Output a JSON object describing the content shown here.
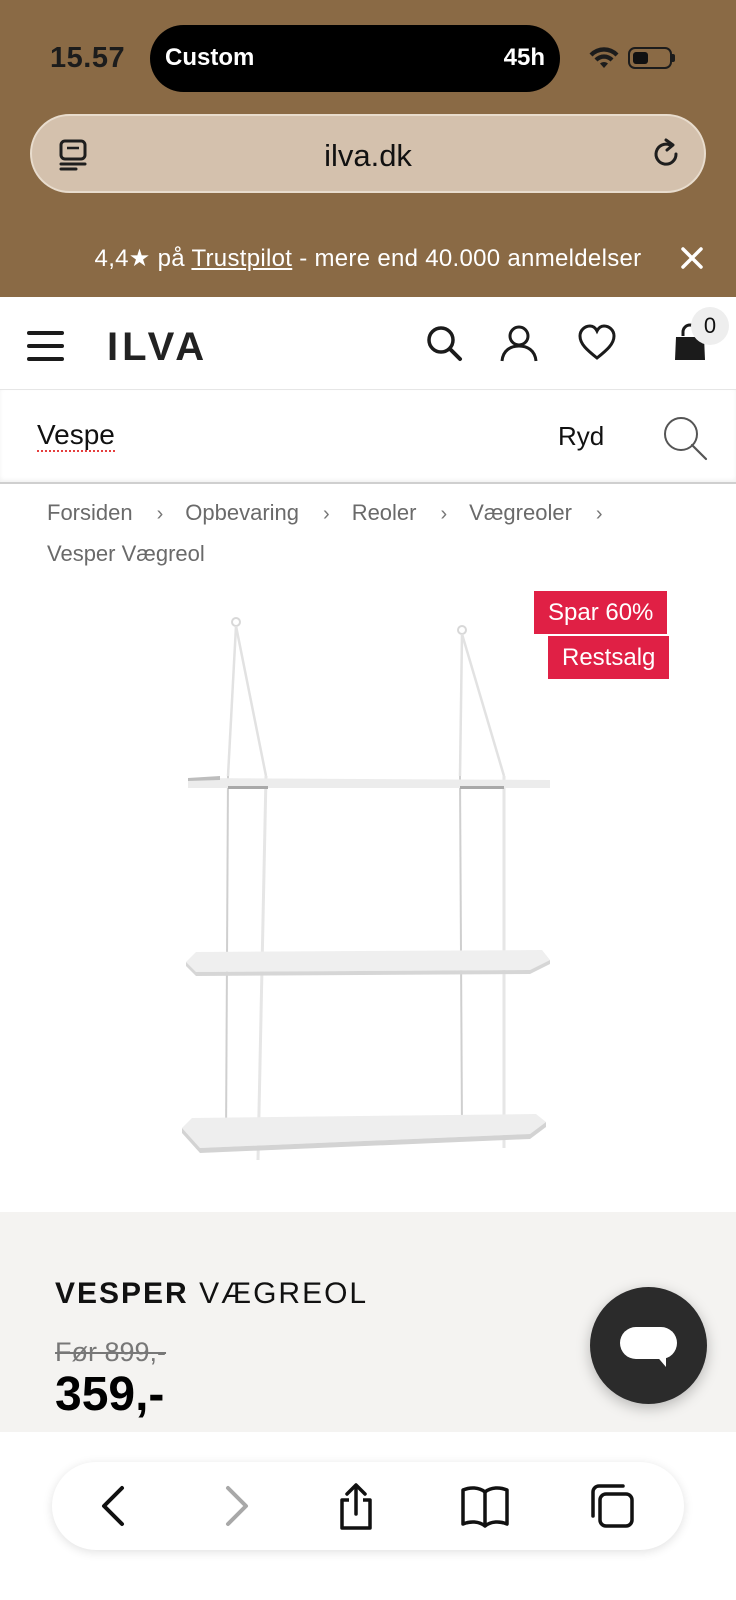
{
  "status_bar": {
    "time": "15.57",
    "island_left": "Custom",
    "island_right": "45h",
    "battery_level": 0.45
  },
  "browser": {
    "url": "ilva.dk"
  },
  "promo": {
    "prefix": "4,4★ på ",
    "link": "Trustpilot",
    "suffix": " - mere end 40.000 anmeldelser"
  },
  "header": {
    "logo": "ILVA",
    "cart_count": "0"
  },
  "search": {
    "value": "Vespe",
    "clear_label": "Ryd"
  },
  "breadcrumb": [
    "Forsiden",
    "Opbevaring",
    "Reoler",
    "Vægreoler",
    "Vesper Vægreol"
  ],
  "badges": {
    "sale": "Spar 60%",
    "clearance": "Restsalg"
  },
  "product": {
    "brand": "VESPER",
    "name": "VÆGREOL",
    "old_price": "Før 899,-",
    "price": "359,-"
  },
  "colors": {
    "top_background": "#8a6a45",
    "url_bar": "#d4c1ad",
    "badge_red": "#e02045",
    "info_panel": "#f4f3f1"
  },
  "icons": {
    "tabs": "tabs-icon",
    "reload": "reload-icon",
    "close": "close-icon",
    "menu": "hamburger-icon",
    "search": "search-icon",
    "account": "user-icon",
    "wishlist": "heart-icon",
    "cart": "bag-icon",
    "chat": "chat-icon",
    "back": "chevron-left-icon",
    "forward": "chevron-right-icon",
    "share": "share-icon",
    "bookmarks": "book-icon",
    "tab_switcher": "tabs-switcher-icon"
  }
}
